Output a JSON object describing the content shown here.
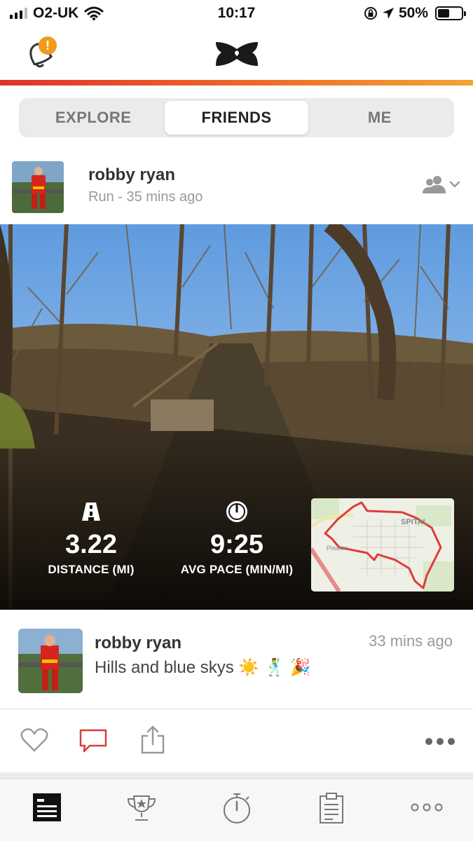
{
  "status_bar": {
    "carrier": "O2-UK",
    "time": "10:17",
    "battery": "50%",
    "battery_level": 0.5
  },
  "header": {
    "notification_badge": "!",
    "logo": "under-armour-logo",
    "brand_colors": [
      "#e0322a",
      "#ef6a28",
      "#f4a431"
    ]
  },
  "tabs": [
    {
      "label": "EXPLORE",
      "active": false
    },
    {
      "label": "FRIENDS",
      "active": true
    },
    {
      "label": "ME",
      "active": false
    }
  ],
  "post": {
    "user_name": "robby ryan",
    "meta": "Run - 35 mins ago",
    "privacy_icon": "friends-icon",
    "stats": [
      {
        "icon": "road-icon",
        "value": "3.22",
        "label": "DISTANCE (MI)"
      },
      {
        "icon": "gauge-icon",
        "value": "9:25",
        "label": "AVG PACE (MIN/MI)"
      }
    ],
    "map_labels": [
      "SPITAL",
      "Poulton"
    ]
  },
  "comment": {
    "user_name": "robby ryan",
    "text": "Hills and blue skys ☀️ 🕺 🎉",
    "time": "33 mins ago"
  },
  "actions": {
    "like_icon": "heart-icon",
    "comment_icon": "comment-icon",
    "share_icon": "share-icon",
    "more_icon": "more-dots-icon"
  },
  "bottom_nav": [
    {
      "icon": "feed-icon",
      "active": true
    },
    {
      "icon": "trophy-icon",
      "active": false
    },
    {
      "icon": "stopwatch-icon",
      "active": false
    },
    {
      "icon": "clipboard-icon",
      "active": false
    },
    {
      "icon": "more-icon",
      "active": false
    }
  ]
}
